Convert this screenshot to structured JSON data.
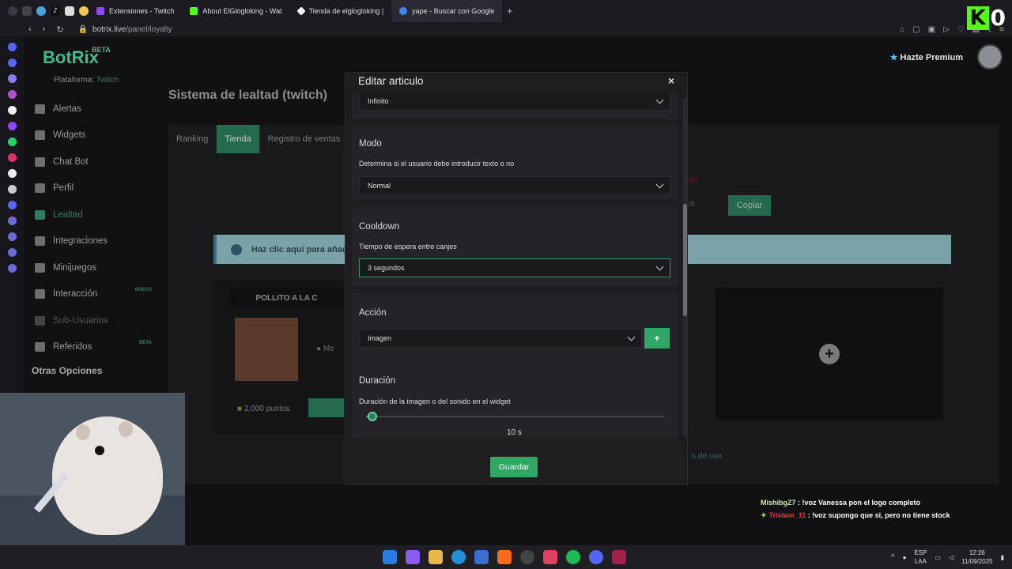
{
  "browser": {
    "tabs": [
      {
        "label": "Extensiones - Twitch",
        "color": "#9146ff"
      },
      {
        "label": "About ElGlogloking - Wat",
        "color": "#53fc18"
      },
      {
        "label": "Tienda de elglogloking |",
        "color": "#ffffff"
      },
      {
        "label": "yape - Buscar con Google",
        "color": "#4285f4"
      }
    ],
    "newtab": "+",
    "url_host": "botrix.live",
    "url_path": "/panel/loyalty"
  },
  "overlay": {
    "k": "K",
    "count": "0"
  },
  "app": {
    "brand": "BotRix",
    "brand_tag": "BETA",
    "premium": "Hazte Premium",
    "platform_label": "Plataforma:",
    "platform_value": "Twitch",
    "sidebar": [
      {
        "label": "Alertas",
        "tag": ""
      },
      {
        "label": "Widgets",
        "tag": ""
      },
      {
        "label": "Chat Bot",
        "tag": ""
      },
      {
        "label": "Perfil",
        "tag": ""
      },
      {
        "label": "Lealtad",
        "tag": ""
      },
      {
        "label": "Integraciones",
        "tag": ""
      },
      {
        "label": "Minijuegos",
        "tag": ""
      },
      {
        "label": "Interacción",
        "tag": "NUEVO"
      },
      {
        "label": "Sub-Usuarios",
        "tag": ""
      },
      {
        "label": "Referidos",
        "tag": "BETA"
      }
    ],
    "other_options": "Otras Opciones",
    "page_title": "Sistema de lealtad (twitch)",
    "tabs": [
      "Ranking",
      "Tienda",
      "Registro de ventas"
    ],
    "chat_link": "chat",
    "input_hint": "ática",
    "copy_button": "Copiar",
    "info_banner": "Haz clic aquí para añadi",
    "item_card": {
      "title": "POLLITO A LA C",
      "message_hint": "Me",
      "points": "2,000 puntos"
    },
    "terms": "s de uso."
  },
  "modal": {
    "title": "Editar articulo",
    "close": "×",
    "top_select": "Infinito",
    "modo": {
      "title": "Modo",
      "desc": "Determina si el usuario debe introducir texto o no",
      "value": "Normal"
    },
    "cooldown": {
      "title": "Cooldown",
      "desc": "Tiempo de espera entre canjes",
      "value": "3 segundos"
    },
    "accion": {
      "title": "Acción",
      "value": "Imagen",
      "add": "+"
    },
    "duracion": {
      "title": "Duración",
      "desc": "Duración de la imagen o del sonido en el widget",
      "value": "10 s",
      "level": 0.02
    },
    "save": "Guardar"
  },
  "chat": [
    {
      "user": "MishibgZ7",
      "text": " : !voz Vanessa pon el logo completo"
    },
    {
      "user": "Tristam_11",
      "text": " : !voz supongo que si, pero no tiene stock"
    }
  ],
  "taskbar": {
    "lang": "ESP",
    "lang2": "LAA",
    "time": "12:26",
    "date": "11/09/2025"
  }
}
